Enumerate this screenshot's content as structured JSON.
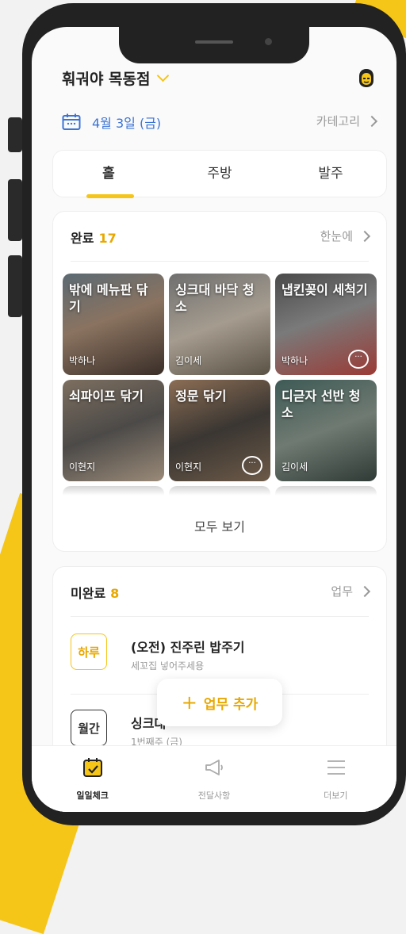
{
  "colors": {
    "accent": "#f5c518",
    "accent_text": "#e8a800",
    "date_blue": "#3b73d6",
    "badge_day": "#f5c518",
    "badge_month": "#333333"
  },
  "header": {
    "store_name": "훠궈야 목동점",
    "avatar_icon": "chef-avatar-icon"
  },
  "date_row": {
    "date": "4월 3일 (금)",
    "category_link": "카테고리"
  },
  "tabs": [
    {
      "label": "홀",
      "active": true
    },
    {
      "label": "주방",
      "active": false
    },
    {
      "label": "발주",
      "active": false
    }
  ],
  "completed": {
    "label": "완료",
    "count": "17",
    "link": "한눈에",
    "tiles": [
      {
        "title": "밖에 메뉴판 닦기",
        "person": "박하나",
        "has_comment": false
      },
      {
        "title": "싱크대 바닥 청소",
        "person": "김이세",
        "has_comment": false
      },
      {
        "title": "냅킨꽂이 세척기",
        "person": "박하나",
        "has_comment": true
      },
      {
        "title": "쇠파이프 닦기",
        "person": "이현지",
        "has_comment": false
      },
      {
        "title": "정문 닦기",
        "person": "이현지",
        "has_comment": true
      },
      {
        "title": "디귿자 선반 청소",
        "person": "김이세",
        "has_comment": false
      }
    ],
    "view_all": "모두 보기"
  },
  "incomplete": {
    "label": "미완료",
    "count": "8",
    "link": "업무",
    "tasks": [
      {
        "badge": "하루",
        "title": "(오전) 진주린 밥주기",
        "subtitle": "세꼬집 넣어주세용"
      },
      {
        "badge": "월간",
        "title": "싱크대",
        "subtitle": "1번째주 (금)"
      }
    ]
  },
  "add_task_button": "업무 추가",
  "bottom_nav": [
    {
      "label": "일일체크",
      "icon": "calendar-check-icon",
      "active": true
    },
    {
      "label": "전달사항",
      "icon": "megaphone-icon",
      "active": false
    },
    {
      "label": "더보기",
      "icon": "menu-icon",
      "active": false
    }
  ]
}
